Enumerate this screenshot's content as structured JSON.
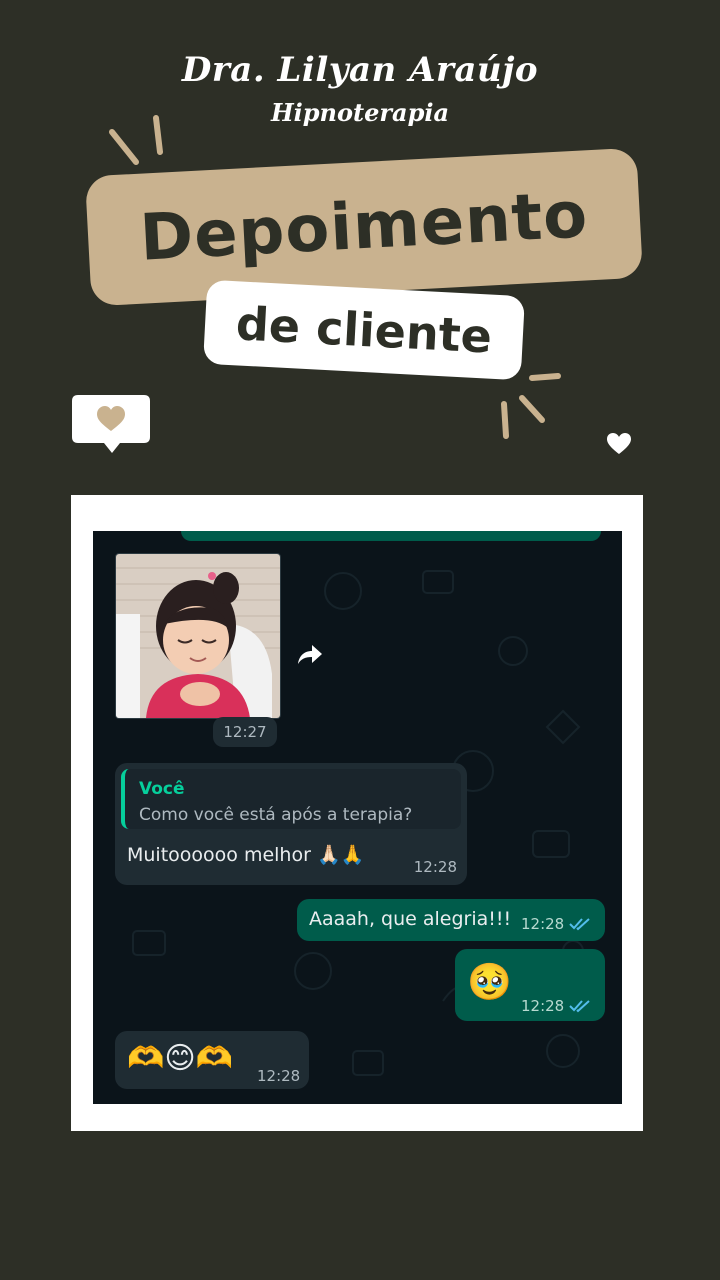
{
  "header": {
    "name": "Dra. Lilyan Araújo",
    "subtitle": "Hipnoterapia"
  },
  "banner": {
    "main": "Depoimento",
    "sub": "de cliente"
  },
  "colors": {
    "background": "#2d2f26",
    "accent": "#c9b28f",
    "chat_background": "#0b141a",
    "incoming_bubble": "#1f2c33",
    "outgoing_bubble": "#005c4b",
    "quote_accent": "#06cf9c",
    "read_ticks": "#53bdeb"
  },
  "chat": {
    "image_message": {
      "time": "12:27",
      "forward_icon": "forward-icon"
    },
    "reply_message": {
      "quoted_author": "Você",
      "quoted_text": "Como você está após a terapia?",
      "text": "Muitoooooo melhor 🙏🏻🙏",
      "time": "12:28"
    },
    "sent_text": {
      "text": "Aaaah, que alegria!!!",
      "time": "12:28",
      "status_icon": "double-check-read-icon"
    },
    "sent_emoji": {
      "text": "🥹",
      "time": "12:28",
      "status_icon": "double-check-read-icon"
    },
    "received_emoji": {
      "text": "🫶😊🫶",
      "time": "12:28"
    }
  }
}
